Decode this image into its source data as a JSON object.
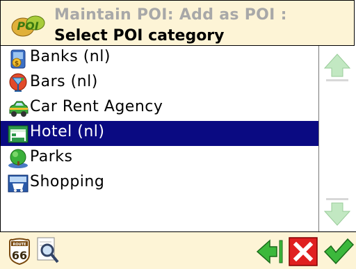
{
  "header": {
    "title_line1": "Maintain POI: Add as POI :",
    "title_line2": "Select POI category",
    "logo_icon": "poi-logo"
  },
  "categories": [
    {
      "label": "Banks (nl)",
      "icon": "bank-icon",
      "selected": false
    },
    {
      "label": "Bars (nl)",
      "icon": "bar-icon",
      "selected": false
    },
    {
      "label": "Car Rent Agency",
      "icon": "car-rent-icon",
      "selected": false
    },
    {
      "label": "Hotel (nl)",
      "icon": "hotel-icon",
      "selected": true
    },
    {
      "label": "Parks",
      "icon": "park-icon",
      "selected": false
    },
    {
      "label": "Shopping",
      "icon": "shopping-icon",
      "selected": false
    }
  ],
  "scrollbar": {
    "up_icon": "scroll-up-icon",
    "down_icon": "scroll-down-icon"
  },
  "footer": {
    "route_badge_text": "ROUTE",
    "route_badge_number": "66",
    "icons": [
      "route-66-icon",
      "magnifier-icon",
      "back-icon",
      "cancel-icon",
      "confirm-icon"
    ]
  },
  "colors": {
    "header_bg": "#fdf4d6",
    "selected_bg": "#0a0a82",
    "title_grey": "#a8a8a8",
    "cancel_red": "#e02020",
    "confirm_green": "#3cb83c"
  }
}
